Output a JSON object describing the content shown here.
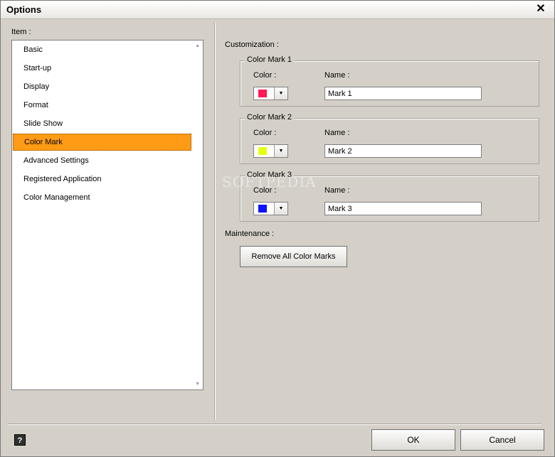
{
  "window": {
    "title": "Options"
  },
  "item_panel": {
    "label": "Item :",
    "items": [
      "Basic",
      "Start-up",
      "Display",
      "Format",
      "Slide Show",
      "Color Mark",
      "Advanced Settings",
      "Registered Application",
      "Color Management"
    ],
    "selected": "Color Mark",
    "selected_color": "#ff9b14"
  },
  "customization": {
    "label": "Customization :",
    "color_label": "Color :",
    "name_label": "Name :",
    "marks": [
      {
        "title": "Color Mark 1",
        "color": "#ff1a55",
        "name": "Mark 1"
      },
      {
        "title": "Color Mark 2",
        "color": "#e6ff14",
        "name": "Mark 2"
      },
      {
        "title": "Color Mark 3",
        "color": "#0a14ff",
        "name": "Mark 3"
      }
    ]
  },
  "maintenance": {
    "label": "Maintenance :",
    "remove_button": "Remove All Color Marks"
  },
  "footer": {
    "help": "?",
    "ok": "OK",
    "cancel": "Cancel"
  },
  "watermark": "SOFTPEDIA"
}
